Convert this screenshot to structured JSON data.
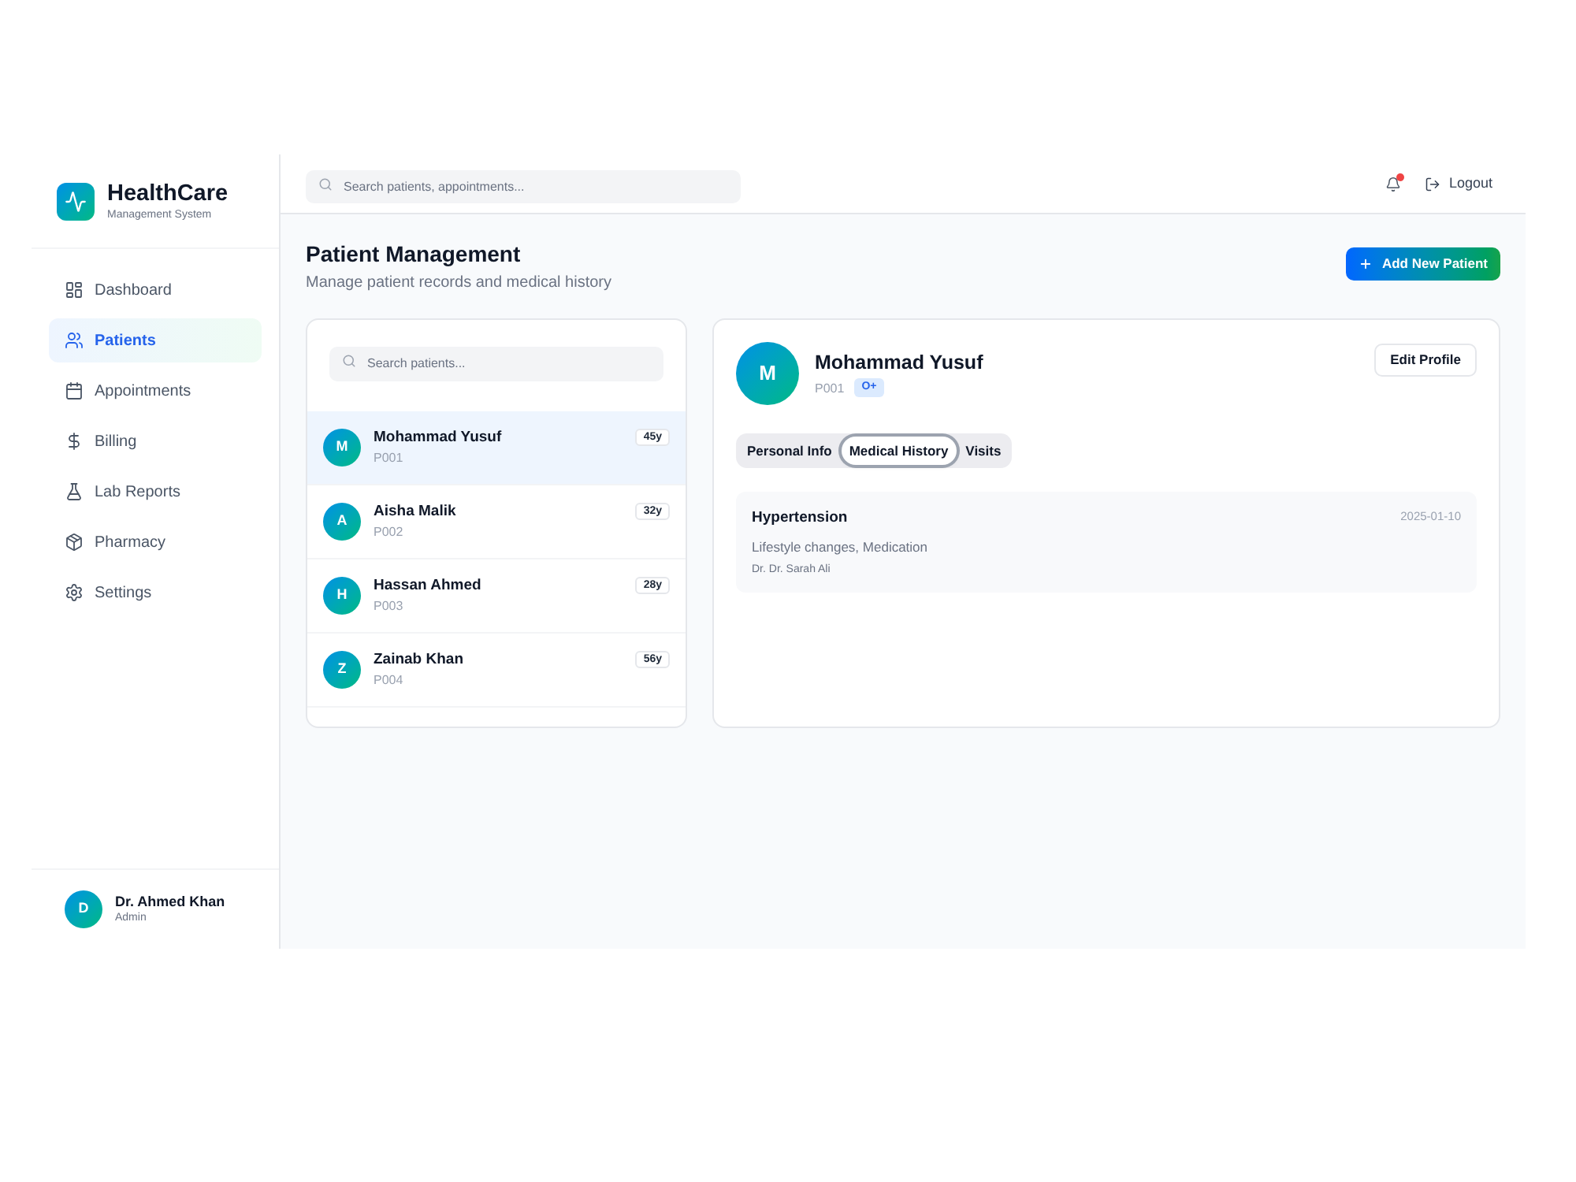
{
  "brand": {
    "name": "HealthCare",
    "tagline": "Management System"
  },
  "sidebar": {
    "items": [
      {
        "label": "Dashboard",
        "selected": false
      },
      {
        "label": "Patients",
        "selected": true
      },
      {
        "label": "Appointments",
        "selected": false
      },
      {
        "label": "Billing",
        "selected": false
      },
      {
        "label": "Lab Reports",
        "selected": false
      },
      {
        "label": "Pharmacy",
        "selected": false
      },
      {
        "label": "Settings",
        "selected": false
      }
    ]
  },
  "user": {
    "initial": "D",
    "name": "Dr. Ahmed Khan",
    "role": "Admin"
  },
  "top_bar": {
    "search": {
      "placeholder": "Search patients, appointments..."
    },
    "notifications": {
      "unread": true
    },
    "logout": "Logout"
  },
  "page": {
    "title": "Patient Management",
    "subtitle": "Manage patient records and medical history",
    "add_button": "Add New Patient"
  },
  "patient_list": {
    "search": {
      "placeholder": "Search patients..."
    },
    "patients": [
      {
        "initial": "M",
        "name": "Mohammad Yusuf",
        "id": "P001",
        "age": "45y",
        "selected": true
      },
      {
        "initial": "A",
        "name": "Aisha Malik",
        "id": "P002",
        "age": "32y",
        "selected": false
      },
      {
        "initial": "H",
        "name": "Hassan Ahmed",
        "id": "P003",
        "age": "28y",
        "selected": false
      },
      {
        "initial": "Z",
        "name": "Zainab Khan",
        "id": "P004",
        "age": "56y",
        "selected": false
      }
    ]
  },
  "patient_detail": {
    "initial": "M",
    "name": "Mohammad Yusuf",
    "id": "P001",
    "blood_group": "O+",
    "edit_button": "Edit Profile",
    "tabs": [
      {
        "label": "Personal Info",
        "selected": false
      },
      {
        "label": "Medical History",
        "selected": true
      },
      {
        "label": "Visits",
        "selected": false
      }
    ],
    "records": [
      {
        "condition": "Hypertension",
        "date": "2025-01-10",
        "treatment": "Lifestyle changes, Medication",
        "doctor": "Dr. Dr. Sarah Ali"
      }
    ]
  }
}
